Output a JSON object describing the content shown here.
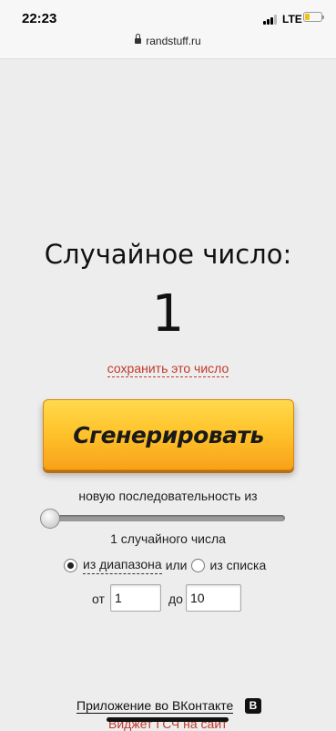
{
  "status": {
    "time": "22:23",
    "network": "LTE",
    "battery_level": 0.25
  },
  "browser": {
    "url": "randstuff.ru"
  },
  "main": {
    "title": "Случайное число:",
    "number": "1",
    "save_link": "сохранить это число",
    "generate_button": "Сгенерировать",
    "sequence_label": "новую последовательность из",
    "slider_value": 1,
    "count_label": "1 случайного числа",
    "mode_range": "из диапазона",
    "mode_or": "или",
    "mode_list": "из списка",
    "from_label": "от",
    "from_value": "1",
    "to_label": "до",
    "to_value": "10"
  },
  "footer": {
    "vk_app_link": "Приложение во ВКонтакте",
    "vk_icon": "vk-icon",
    "vk_icon_glyph": "В",
    "widget_link": "Виджет ГСЧ на сайт"
  },
  "colors": {
    "accent_link": "#c0392b",
    "button_yellow": "#ffc42c"
  }
}
